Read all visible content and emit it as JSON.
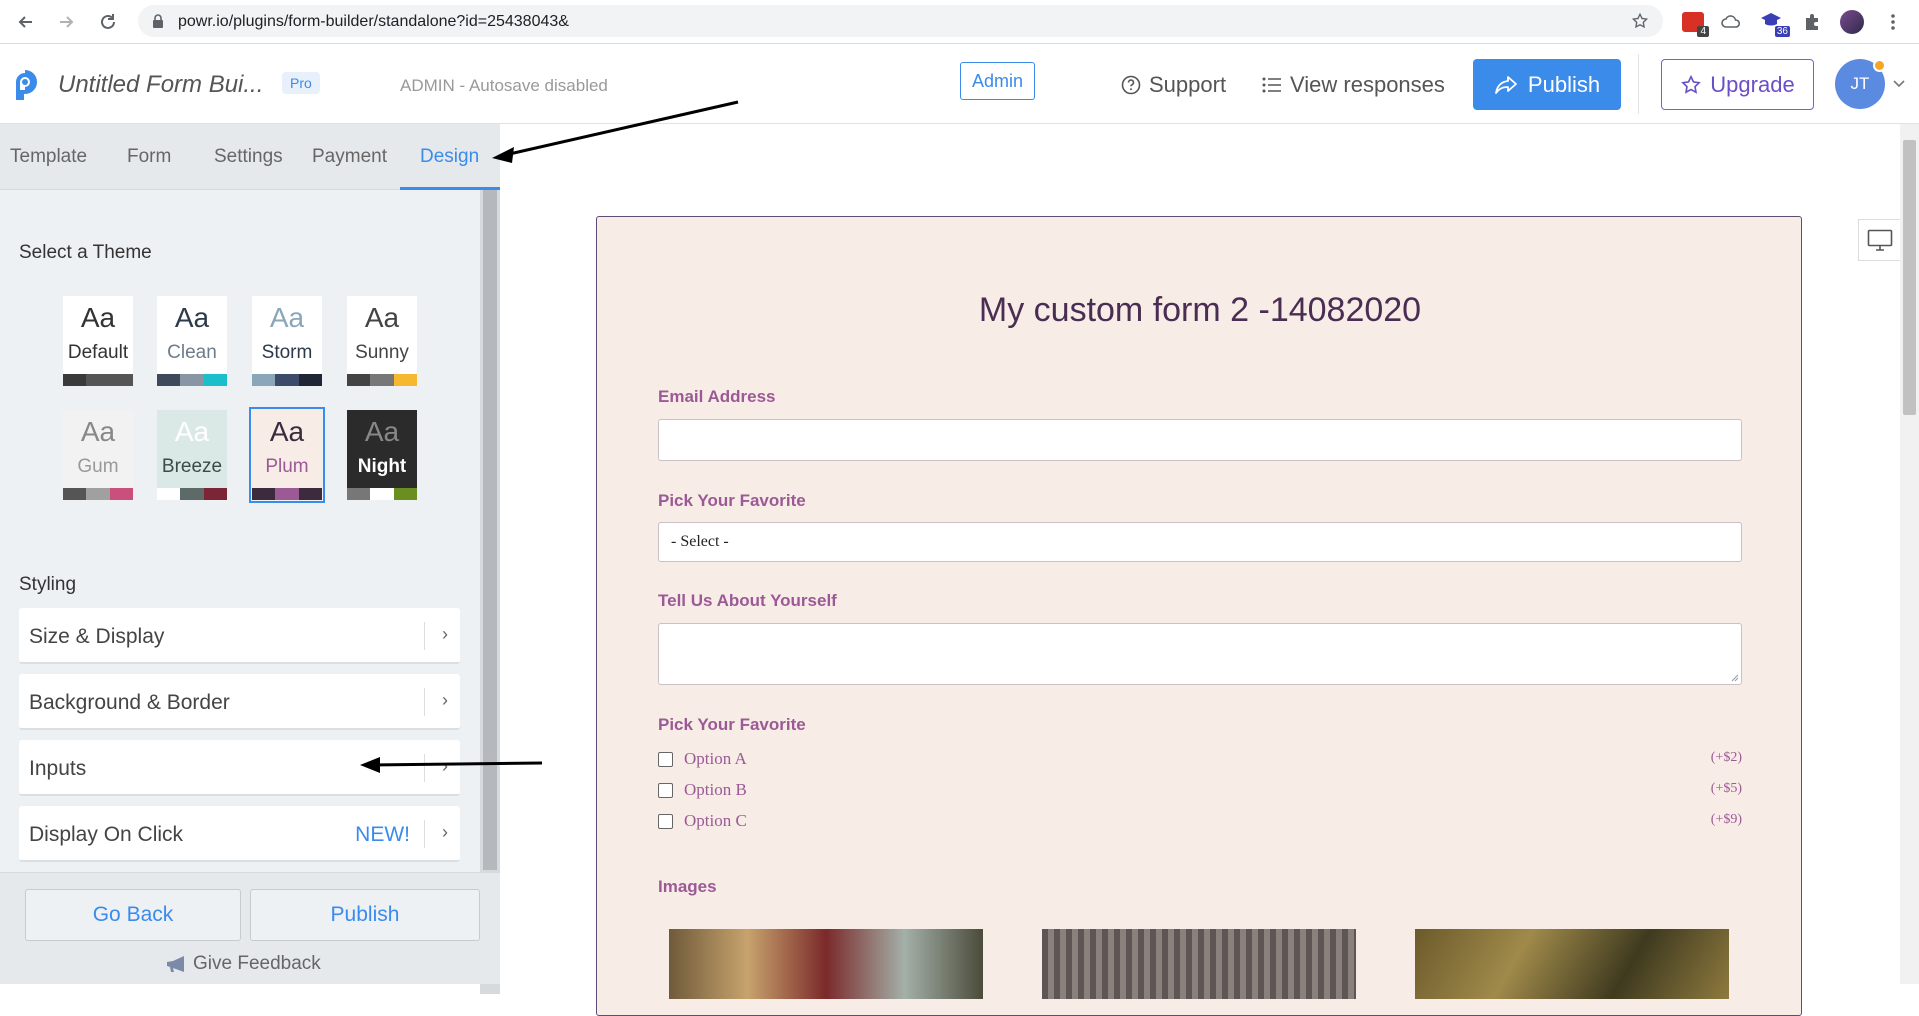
{
  "browser": {
    "url": "powr.io/plugins/form-builder/standalone?id=25438043&",
    "ext_badge_1": "4",
    "ext_badge_2": "36"
  },
  "header": {
    "form_title": "Untitled Form Bui...",
    "pro_badge": "Pro",
    "admin_note": "ADMIN - Autosave disabled",
    "admin_badge": "Admin",
    "support": "Support",
    "view_responses": "View responses",
    "publish": "Publish",
    "upgrade": "Upgrade",
    "avatar_initials": "JT"
  },
  "tabs": [
    "Template",
    "Form",
    "Settings",
    "Payment",
    "Design"
  ],
  "active_tab": "Design",
  "themes": {
    "title": "Select a Theme",
    "items": [
      {
        "name": "Default",
        "aa": "Aa",
        "bg": "#ffffff",
        "aa_color": "#333333",
        "name_color": "#333333",
        "swatches": [
          "#3a3a3a",
          "#555555",
          "#555555"
        ]
      },
      {
        "name": "Clean",
        "aa": "Aa",
        "bg": "#ffffff",
        "aa_color": "#2d3a4a",
        "name_color": "#6e7b8a",
        "swatches": [
          "#3e4a5c",
          "#8a95a3",
          "#1bbfc9"
        ]
      },
      {
        "name": "Storm",
        "aa": "Aa",
        "bg": "#ffffff",
        "aa_color": "#8aa6b8",
        "name_color": "#2d3a4a",
        "swatches": [
          "#8aa6b8",
          "#3e4a6a",
          "#1f2636"
        ]
      },
      {
        "name": "Sunny",
        "aa": "Aa",
        "bg": "#ffffff",
        "aa_color": "#444444",
        "name_color": "#444444",
        "swatches": [
          "#444444",
          "#777777",
          "#f5b82e"
        ]
      },
      {
        "name": "Gum",
        "aa": "Aa",
        "bg": "#f2f2f2",
        "aa_color": "#888888",
        "name_color": "#999999",
        "swatches": [
          "#555555",
          "#a0a0a0",
          "#c9507a"
        ]
      },
      {
        "name": "Breeze",
        "aa": "Aa",
        "bg": "#dbe9e6",
        "aa_color": "#ffffff",
        "name_color": "#3c4a48",
        "swatches": [
          "#ffffff",
          "#5e6a68",
          "#7a2636"
        ]
      },
      {
        "name": "Plum",
        "aa": "Aa",
        "bg": "#f8ece7",
        "aa_color": "#3c2a3f",
        "name_color": "#9b5a95",
        "swatches": [
          "#3c2a3f",
          "#9b5a95",
          "#3c2a3f"
        ]
      },
      {
        "name": "Night",
        "aa": "Aa",
        "bg": "#2b2b2b",
        "aa_color": "#888888",
        "name_color": "#ffffff",
        "swatches": [
          "#777777",
          "#ffffff",
          "#6a8e1f"
        ]
      }
    ],
    "selected": "Plum"
  },
  "styling": {
    "title": "Styling",
    "rows": [
      {
        "label": "Size & Display",
        "badge": ""
      },
      {
        "label": "Background & Border",
        "badge": ""
      },
      {
        "label": "Inputs",
        "badge": ""
      },
      {
        "label": "Display On Click",
        "badge": "NEW!"
      }
    ]
  },
  "bottom": {
    "go_back": "Go Back",
    "publish": "Publish",
    "feedback": "Give Feedback"
  },
  "form": {
    "heading": "My custom form 2 -14082020",
    "email_label": "Email Address",
    "pick_label_1": "Pick Your Favorite",
    "select_value": "- Select -",
    "about_label": "Tell Us About Yourself",
    "pick_label_2": "Pick Your Favorite",
    "options": [
      {
        "label": "Option A",
        "price": "(+$2)"
      },
      {
        "label": "Option B",
        "price": "(+$5)"
      },
      {
        "label": "Option C",
        "price": "(+$9)"
      }
    ],
    "images_label": "Images"
  },
  "colors": {
    "accent": "#3b8beb",
    "plum_bg": "#f8ece7",
    "plum_label": "#9b5a95",
    "upgrade": "#6a4fc9"
  }
}
